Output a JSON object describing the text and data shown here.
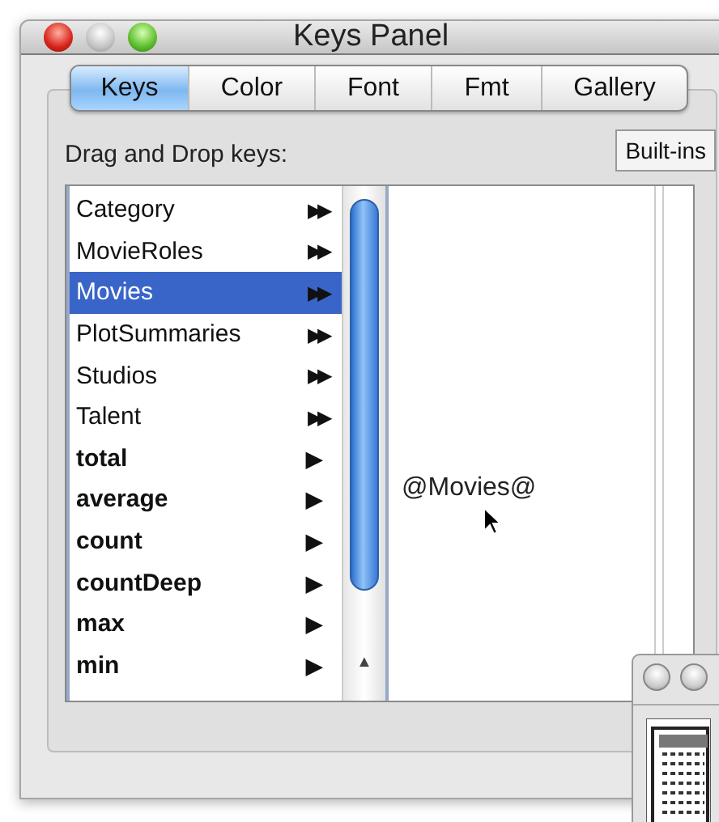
{
  "window": {
    "title": "Keys Panel"
  },
  "tabs": [
    {
      "label": "Keys",
      "selected": true
    },
    {
      "label": "Color",
      "selected": false
    },
    {
      "label": "Font",
      "selected": false
    },
    {
      "label": "Fmt",
      "selected": false
    },
    {
      "label": "Gallery",
      "selected": false
    }
  ],
  "section_label": "Drag and Drop keys:",
  "builtins_button": "Built-ins",
  "keys": [
    {
      "label": "Category",
      "kind": "table",
      "arrow": "▶▶",
      "selected": false
    },
    {
      "label": "MovieRoles",
      "kind": "table",
      "arrow": "▶▶",
      "selected": false
    },
    {
      "label": "Movies",
      "kind": "table",
      "arrow": "▶▶",
      "selected": true
    },
    {
      "label": "PlotSummaries",
      "kind": "table",
      "arrow": "▶▶",
      "selected": false
    },
    {
      "label": "Studios",
      "kind": "table",
      "arrow": "▶▶",
      "selected": false
    },
    {
      "label": "Talent",
      "kind": "table",
      "arrow": "▶▶",
      "selected": false
    },
    {
      "label": "total",
      "kind": "function",
      "arrow": "▶",
      "selected": false
    },
    {
      "label": "average",
      "kind": "function",
      "arrow": "▶",
      "selected": false
    },
    {
      "label": "count",
      "kind": "function",
      "arrow": "▶",
      "selected": false
    },
    {
      "label": "countDeep",
      "kind": "function",
      "arrow": "▶",
      "selected": false
    },
    {
      "label": "max",
      "kind": "function",
      "arrow": "▶",
      "selected": false
    },
    {
      "label": "min",
      "kind": "function",
      "arrow": "▶",
      "selected": false
    }
  ],
  "scroll_up_arrow": "▲",
  "preview_text": "@Movies@"
}
